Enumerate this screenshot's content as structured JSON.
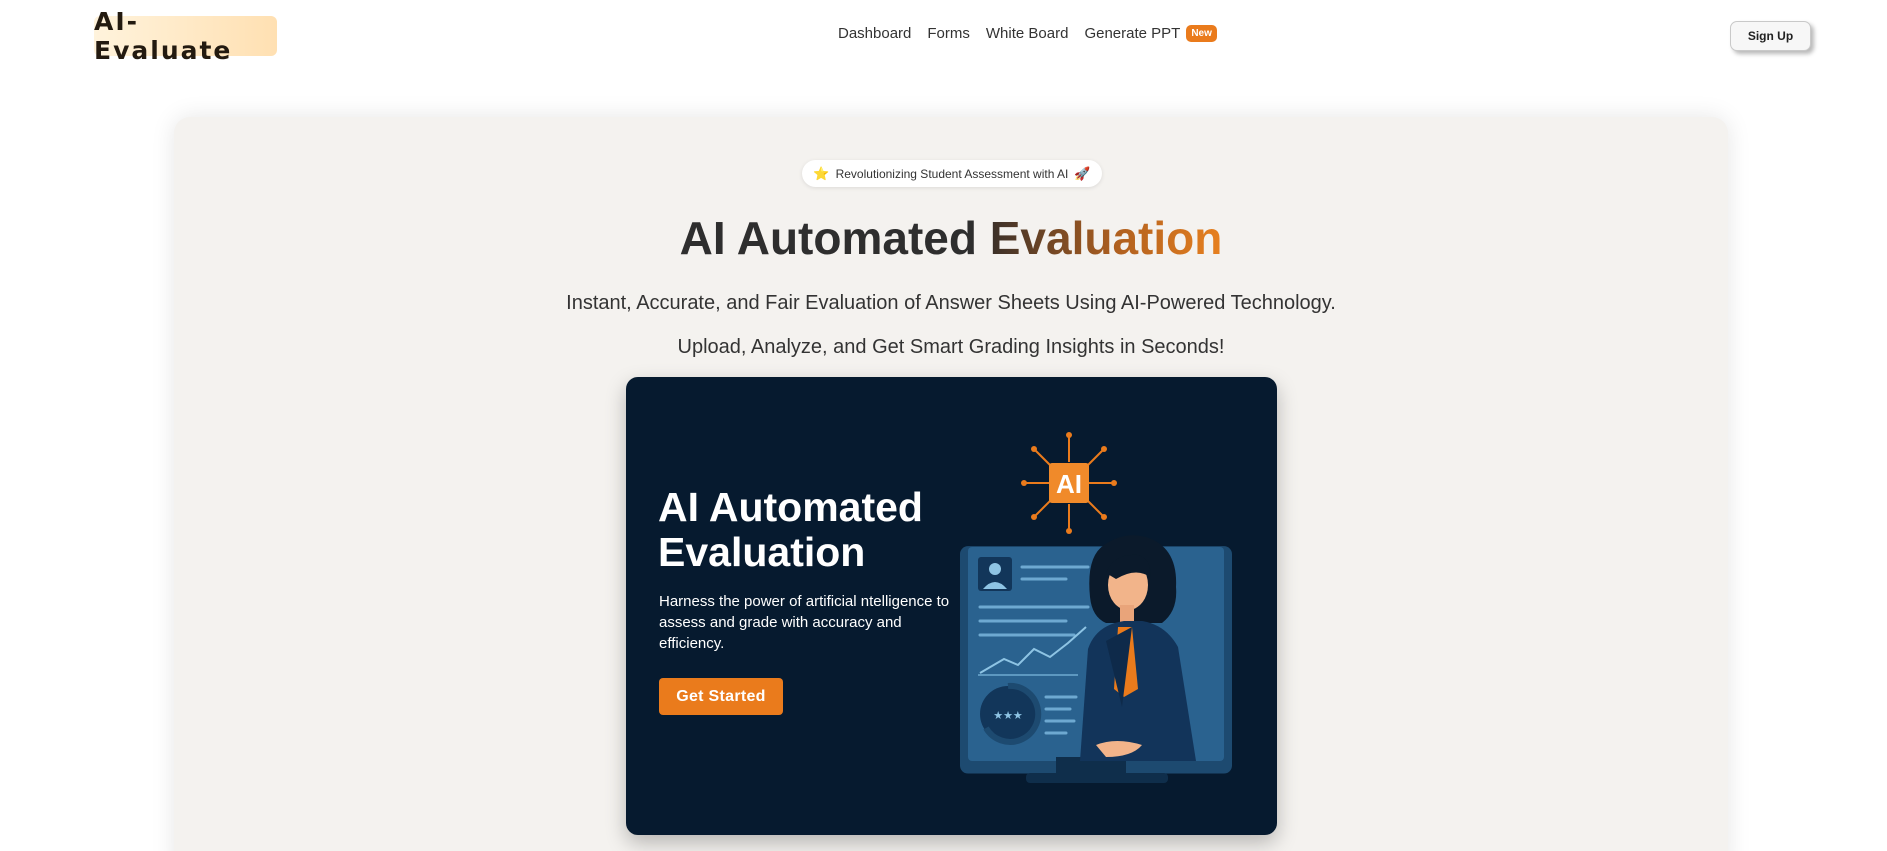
{
  "header": {
    "logo": "AI-Evaluate",
    "nav": [
      {
        "label": "Dashboard"
      },
      {
        "label": "Forms"
      },
      {
        "label": "White Board"
      },
      {
        "label": "Generate PPT",
        "badge": "New"
      }
    ],
    "signup_label": "Sign Up"
  },
  "hero": {
    "pill": {
      "icon_left": "⭐",
      "text": "Revolutionizing Student Assessment with AI",
      "icon_right": "🚀"
    },
    "title_plain": "AI Automated ",
    "title_gradient": "Evaluation",
    "subtitle_1": "Instant, Accurate, and Fair Evaluation of Answer Sheets Using AI-Powered Technology.",
    "subtitle_2": "Upload, Analyze, and Get Smart Grading Insights in Seconds!"
  },
  "panel": {
    "title": "AI Automated Evaluation",
    "description": "Harness the power of artificial ntelligence to assess and grade with accuracy and efficiency.",
    "cta_label": "Get Started",
    "chip_label": "AI"
  },
  "colors": {
    "accent": "#ea7b1c",
    "panel_bg": "#061a2f",
    "hero_bg": "#f4f2ef"
  }
}
